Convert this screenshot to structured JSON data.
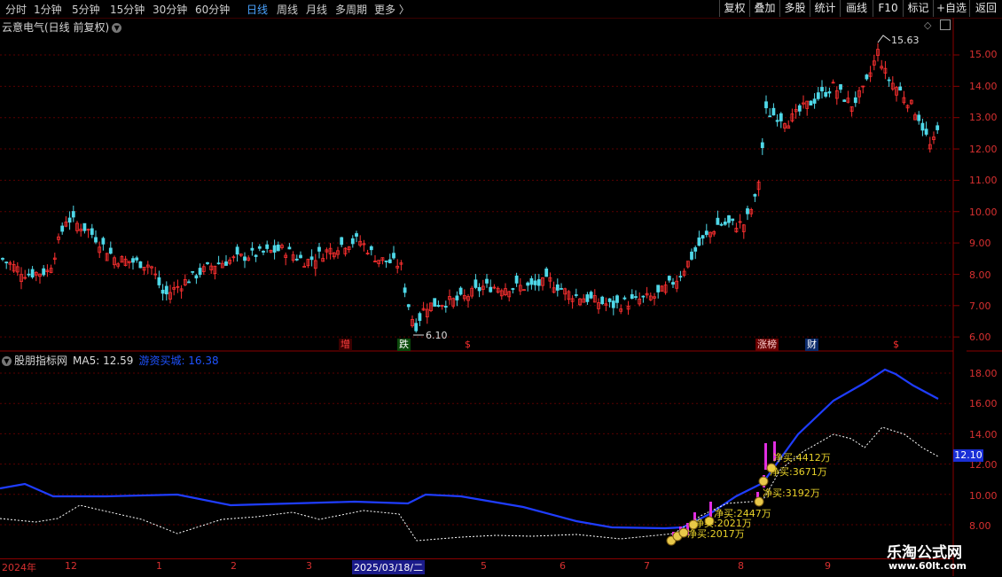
{
  "toolbar": {
    "tabs": [
      {
        "label": "分时",
        "active": false
      },
      {
        "label": "1分钟",
        "active": false
      },
      {
        "label": "5分钟",
        "active": false
      },
      {
        "label": "15分钟",
        "active": false
      },
      {
        "label": "30分钟",
        "active": false
      },
      {
        "label": "60分钟",
        "active": false
      },
      {
        "label": "日线",
        "active": true
      },
      {
        "label": "周线",
        "active": false
      },
      {
        "label": "月线",
        "active": false
      },
      {
        "label": "多周期",
        "active": false
      },
      {
        "label": "更多 〉",
        "active": false
      }
    ],
    "right_buttons": [
      "复权",
      "叠加",
      "多股",
      "统计",
      "画线",
      "F10",
      "标记",
      "+自选",
      "返回"
    ]
  },
  "main_chart": {
    "title": "云意电气(日线 前复权)",
    "price_axis": [
      "15.00",
      "14.00",
      "13.00",
      "12.00",
      "11.00",
      "10.00",
      "9.00",
      "8.00",
      "7.00",
      "6.00"
    ],
    "high_label": "15.63",
    "low_label": "6.10",
    "events": [
      {
        "label": "增",
        "bg": "#3a0000",
        "color": "#ff4040"
      },
      {
        "label": "跌",
        "bg": "#0b4a0b",
        "color": "#ffffff"
      },
      {
        "label": "$",
        "bg": "transparent",
        "color": "#ff3030"
      },
      {
        "label": "涨榜",
        "bg": "#6a0000",
        "color": "#ffd0d0"
      },
      {
        "label": "财",
        "bg": "#0b2a6a",
        "color": "#ffffff"
      },
      {
        "label": "$",
        "bg": "transparent",
        "color": "#ff3030"
      }
    ]
  },
  "indicator": {
    "name": "股朋指标网",
    "ma_label": "MA5: 12.59",
    "second_label": "游资买城: 16.38",
    "axis": [
      "18.00",
      "16.00",
      "14.00",
      "12.00",
      "10.00",
      "8.00"
    ],
    "current_value": "12.10",
    "annotations": [
      "净买:4412万",
      "净买:3671万",
      "净买:3192万",
      "净买:2447万",
      "净买:2021万",
      "净买:2017万"
    ]
  },
  "dates": [
    "2024年",
    "12",
    "1",
    "2",
    "3",
    "2025/03/18/二",
    "5",
    "6",
    "7",
    "8",
    "9"
  ],
  "watermark": {
    "name": "乐淘公式网",
    "url": "www.60lt.com"
  },
  "colors": {
    "up": "#ff3030",
    "down": "#4fd8e8",
    "ma_blue": "#1f3dff",
    "dotted": "#ffffff",
    "grid": "#6a0000",
    "accent": "#4aa3ff"
  }
}
